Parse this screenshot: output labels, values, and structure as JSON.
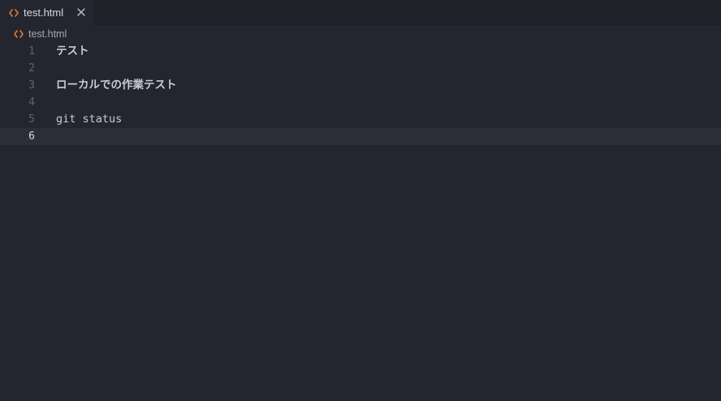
{
  "tab": {
    "label": "test.html",
    "icon": "html-file-icon",
    "icon_color": "#e37933"
  },
  "breadcrumb": {
    "label": "test.html",
    "icon": "html-file-icon"
  },
  "editor": {
    "lines": [
      {
        "number": "1",
        "text": "テスト"
      },
      {
        "number": "2",
        "text": ""
      },
      {
        "number": "3",
        "text": "ローカルでの作業テスト"
      },
      {
        "number": "4",
        "text": ""
      },
      {
        "number": "5",
        "text": "git status"
      },
      {
        "number": "6",
        "text": ""
      }
    ],
    "current_line": "6"
  },
  "colors": {
    "background": "#23262f",
    "tabbar_background": "#1f2128",
    "current_line_highlight": "#2b2e37",
    "html_icon": "#e37933"
  }
}
